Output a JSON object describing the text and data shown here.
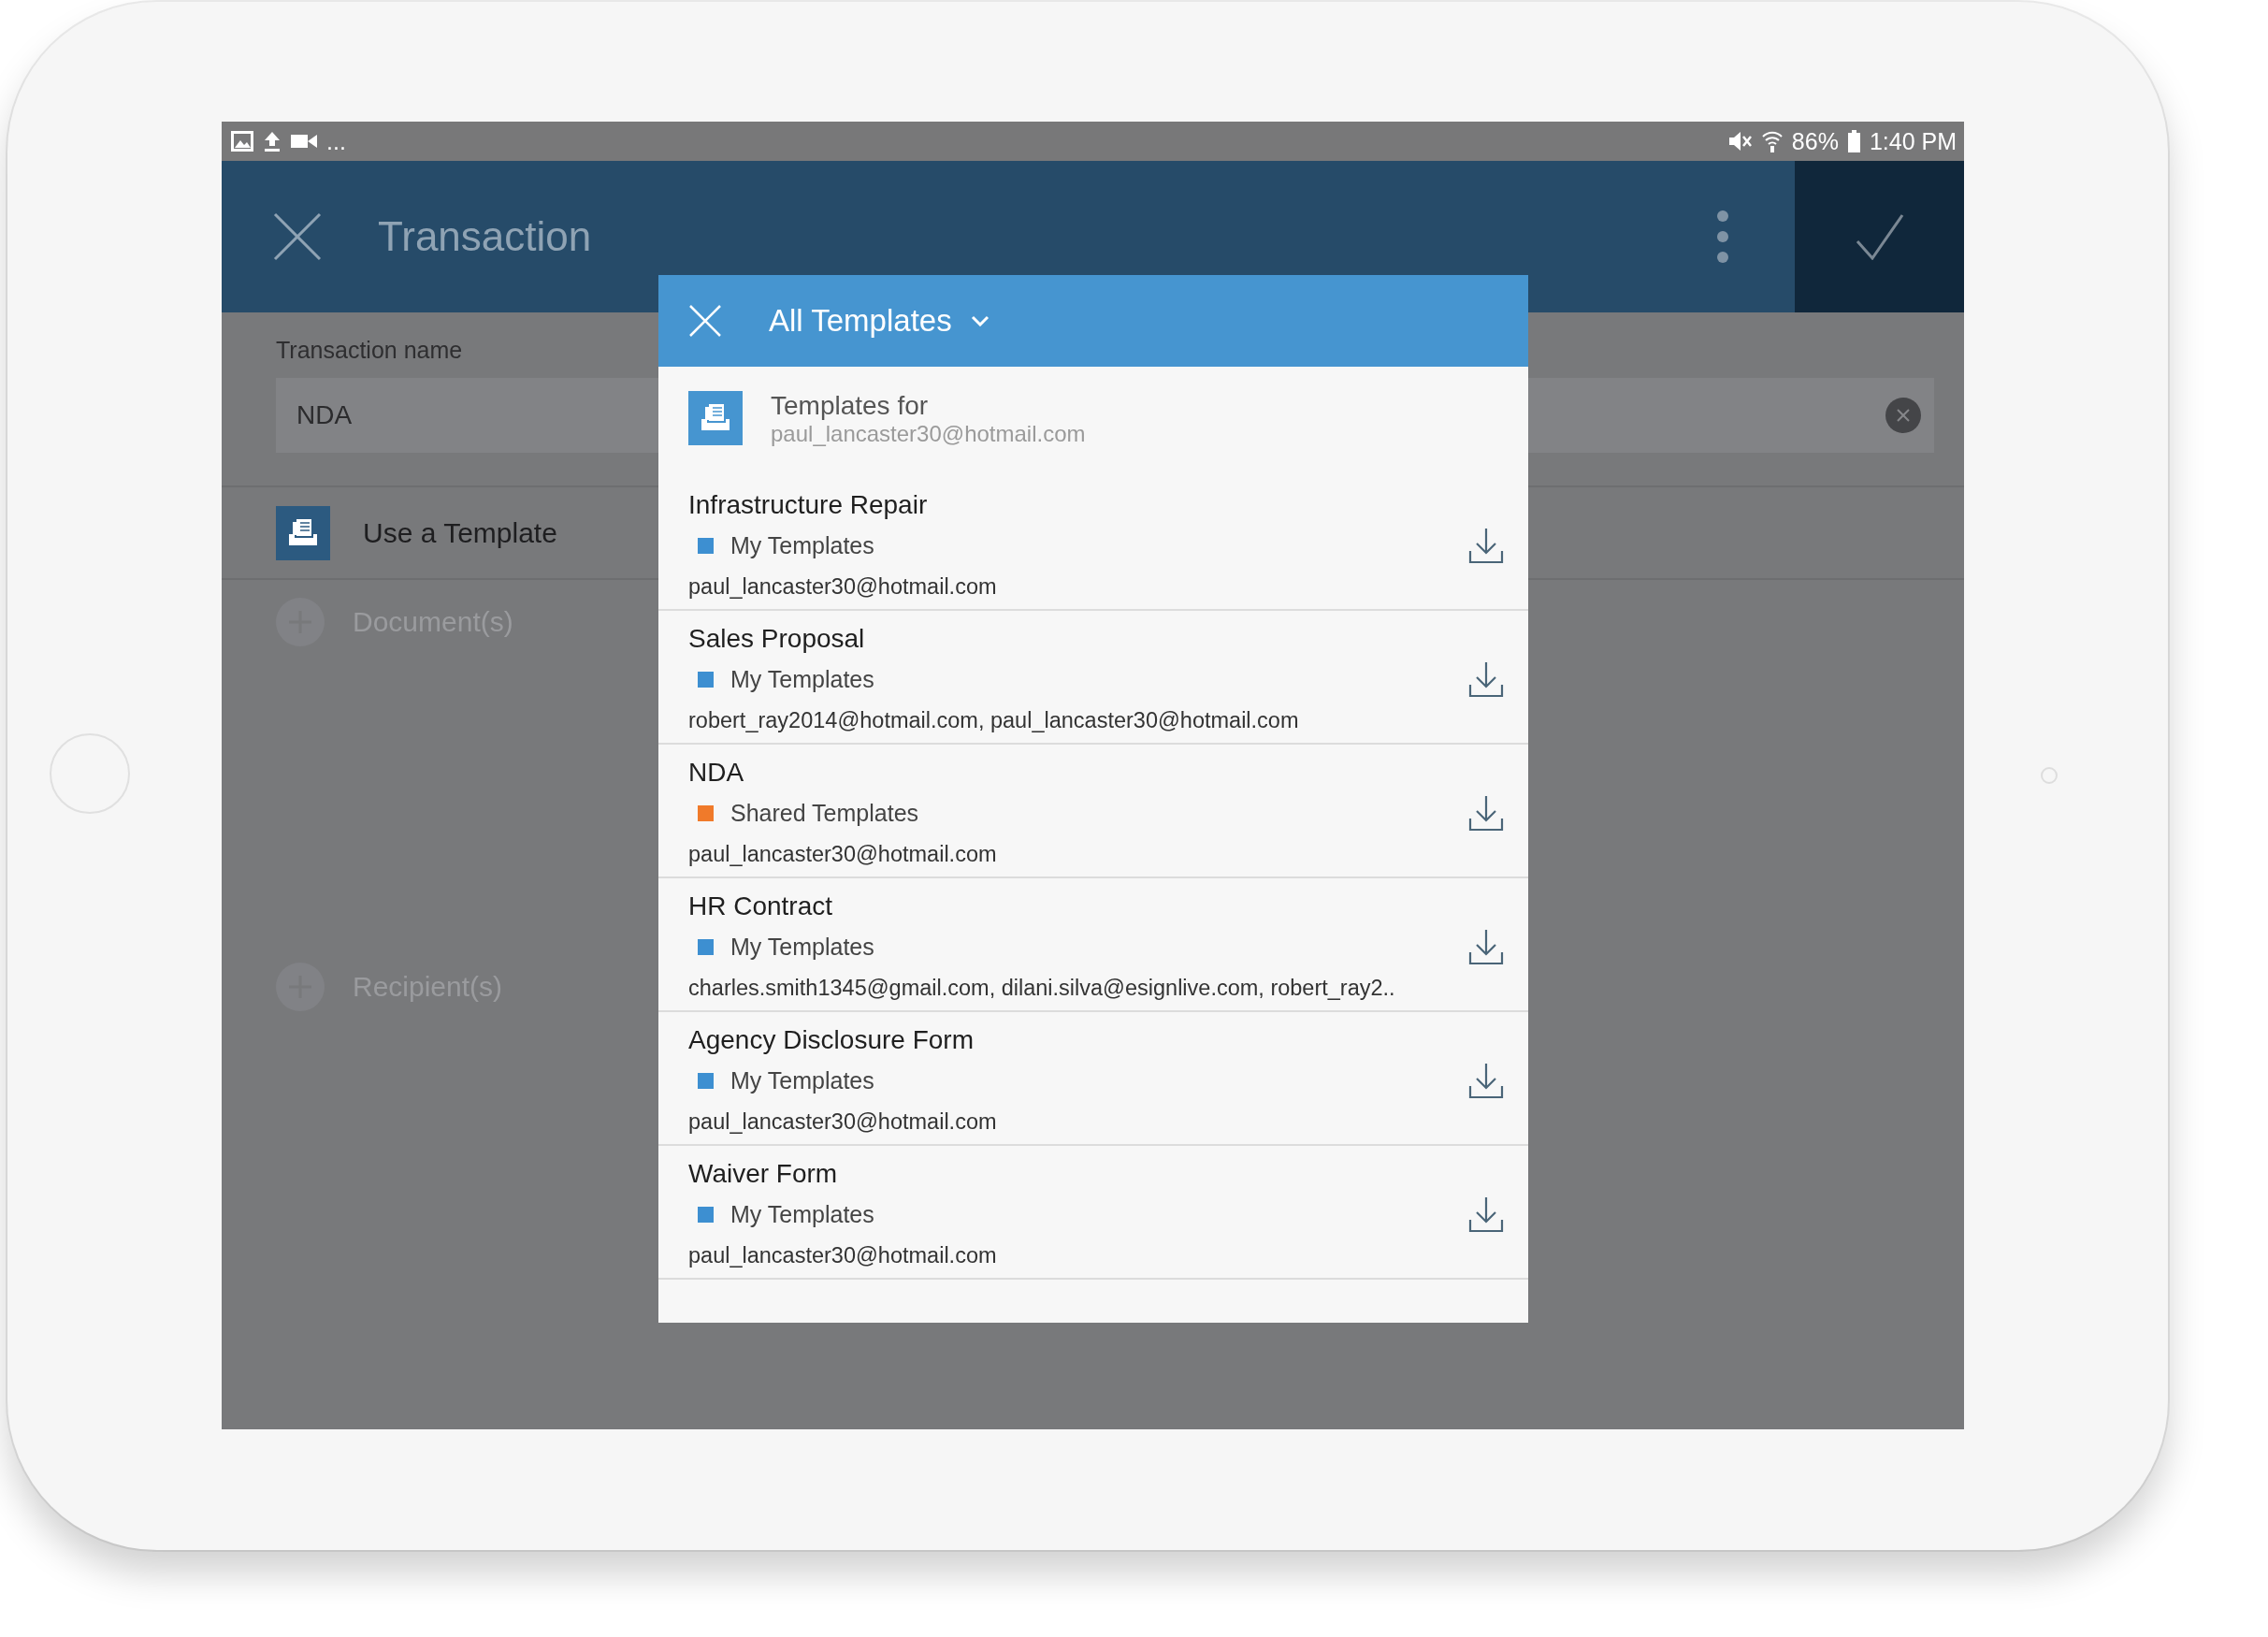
{
  "status_bar": {
    "more": "...",
    "battery": "86%",
    "time": "1:40 PM"
  },
  "app_bar": {
    "title": "Transaction"
  },
  "form": {
    "label": "Transaction name",
    "value": "NDA"
  },
  "use_template": {
    "label": "Use a Template"
  },
  "sections": [
    {
      "label": "Document(s)"
    },
    {
      "label": "Recipient(s)"
    }
  ],
  "dialog": {
    "title": "All Templates",
    "owner_label": "Templates for",
    "owner_email": "paul_lancaster30@hotmail.com",
    "templates": [
      {
        "name": "Infrastructure Repair",
        "category": "My Templates",
        "color": "#3d8fd1",
        "emails": "paul_lancaster30@hotmail.com"
      },
      {
        "name": "Sales Proposal",
        "category": "My Templates",
        "color": "#3d8fd1",
        "emails": "robert_ray2014@hotmail.com, paul_lancaster30@hotmail.com"
      },
      {
        "name": "NDA",
        "category": "Shared Templates",
        "color": "#f07a2a",
        "emails": "paul_lancaster30@hotmail.com"
      },
      {
        "name": "HR Contract",
        "category": "My Templates",
        "color": "#3d8fd1",
        "emails": "charles.smith1345@gmail.com, dilani.silva@esignlive.com, robert_ray2.."
      },
      {
        "name": "Agency Disclosure Form",
        "category": "My Templates",
        "color": "#3d8fd1",
        "emails": "paul_lancaster30@hotmail.com"
      },
      {
        "name": "Waiver Form",
        "category": "My Templates",
        "color": "#3d8fd1",
        "emails": "paul_lancaster30@hotmail.com"
      }
    ]
  }
}
